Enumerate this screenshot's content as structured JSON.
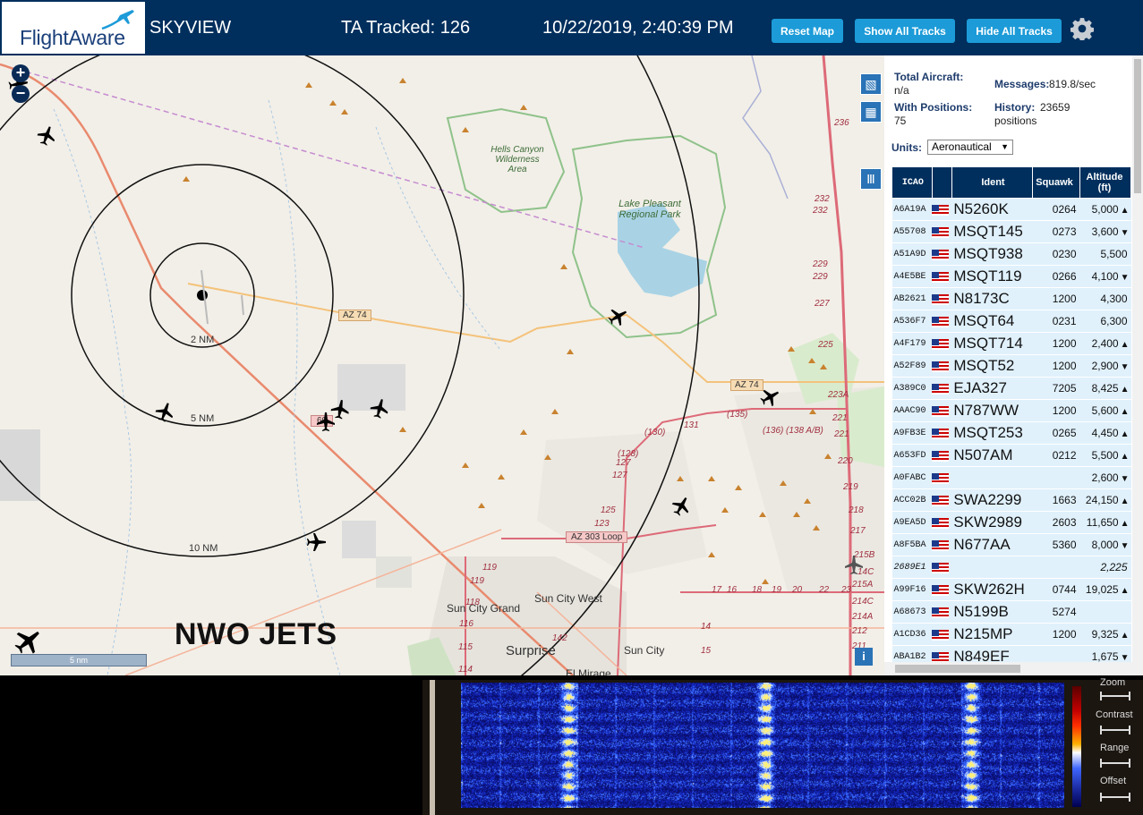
{
  "header": {
    "logo_text": "FlightAware",
    "title": "SKYVIEW",
    "tracked": "TA Tracked: 126",
    "datetime": "10/22/2019, 2:40:39 PM",
    "buttons": [
      "Reset Map",
      "Show All Tracks",
      "Hide All Tracks"
    ]
  },
  "map": {
    "range_labels": [
      "2 NM",
      "5 NM",
      "10 NM"
    ],
    "places": [
      "Hells Canyon Wilderness Area",
      "Lake Pleasant Regional Park",
      "Sun City West",
      "Sun City Grand",
      "Surprise",
      "Sun City",
      "El Mirage"
    ],
    "road_labels": [
      "AZ 74",
      "AZ 74",
      "60",
      "AZ 303 Loop",
      "(130)",
      "131",
      "(135)",
      "(136)",
      "(138 A/B)",
      "(128)",
      "127",
      "127",
      "125",
      "123",
      "119",
      "119",
      "118",
      "116",
      "115",
      "114",
      "142",
      "17",
      "16",
      "18",
      "19",
      "20",
      "22",
      "23",
      "236",
      "232",
      "232",
      "229",
      "229",
      "227",
      "225",
      "223A",
      "221",
      "221",
      "220",
      "219",
      "218",
      "217",
      "215B",
      "215A",
      "214C",
      "214A",
      "212",
      "211",
      "14",
      "15",
      "14C"
    ],
    "scale_label": "5 nm",
    "watermark": "NWO JETS",
    "info": "i"
  },
  "sidebar": {
    "total_aircraft_label": "Total Aircraft:",
    "total_aircraft_value": "n/a",
    "with_positions_label": "With Positions:",
    "with_positions_value": "75",
    "messages_label": "Messages:",
    "messages_value": "819.8/sec",
    "history_label": "History:",
    "history_value": "23659",
    "history_unit": "positions",
    "units_label": "Units:",
    "units_value": "Aeronautical",
    "columns": [
      "ICAO",
      "",
      "Ident",
      "Squawk",
      "Altitude (ft)"
    ],
    "rows": [
      {
        "icao": "A6A19A",
        "ident": "N5260K",
        "squawk": "0264",
        "alt": "5,000",
        "trend": "▲",
        "state": ""
      },
      {
        "icao": "A55708",
        "ident": "MSQT145",
        "squawk": "0273",
        "alt": "3,600",
        "trend": "▼",
        "state": ""
      },
      {
        "icao": "A51A9D",
        "ident": "MSQT938",
        "squawk": "0230",
        "alt": "5,500",
        "trend": "",
        "state": ""
      },
      {
        "icao": "A4E5BE",
        "ident": "MSQT119",
        "squawk": "0266",
        "alt": "4,100",
        "trend": "▼",
        "state": ""
      },
      {
        "icao": "AB2621",
        "ident": "N8173C",
        "squawk": "1200",
        "alt": "4,300",
        "trend": "",
        "state": ""
      },
      {
        "icao": "A536F7",
        "ident": "MSQT64",
        "squawk": "0231",
        "alt": "6,300",
        "trend": "",
        "state": ""
      },
      {
        "icao": "A4F179",
        "ident": "MSQT714",
        "squawk": "1200",
        "alt": "2,400",
        "trend": "▲",
        "state": ""
      },
      {
        "icao": "A52F89",
        "ident": "MSQT52",
        "squawk": "1200",
        "alt": "2,900",
        "trend": "▼",
        "state": ""
      },
      {
        "icao": "A389C0",
        "ident": "EJA327",
        "squawk": "7205",
        "alt": "8,425",
        "trend": "▲",
        "state": ""
      },
      {
        "icao": "AAAC90",
        "ident": "N787WW",
        "squawk": "1200",
        "alt": "5,600",
        "trend": "▲",
        "state": ""
      },
      {
        "icao": "A9FB3E",
        "ident": "MSQT253",
        "squawk": "0265",
        "alt": "4,450",
        "trend": "▲",
        "state": ""
      },
      {
        "icao": "A653FD",
        "ident": "N507AM",
        "squawk": "0212",
        "alt": "5,500",
        "trend": "▲",
        "state": ""
      },
      {
        "icao": "A0FABC",
        "ident": "",
        "squawk": "",
        "alt": "2,600",
        "trend": "▼",
        "state": "sel"
      },
      {
        "icao": "ACC02B",
        "ident": "SWA2299",
        "squawk": "1663",
        "alt": "24,150",
        "trend": "▲",
        "state": ""
      },
      {
        "icao": "A9EA5D",
        "ident": "SKW2989",
        "squawk": "2603",
        "alt": "11,650",
        "trend": "▲",
        "state": ""
      },
      {
        "icao": "A8F5BA",
        "ident": "N677AA",
        "squawk": "5360",
        "alt": "8,000",
        "trend": "▼",
        "state": ""
      },
      {
        "icao": "2689E1",
        "ident": "",
        "squawk": "",
        "alt": "2,225",
        "trend": "",
        "state": "mlat"
      },
      {
        "icao": "A99F16",
        "ident": "SKW262H",
        "squawk": "0744",
        "alt": "19,025",
        "trend": "▲",
        "state": ""
      },
      {
        "icao": "A68673",
        "ident": "N5199B",
        "squawk": "5274",
        "alt": "",
        "trend": "",
        "state": ""
      },
      {
        "icao": "A1CD36",
        "ident": "N215MP",
        "squawk": "1200",
        "alt": "9,325",
        "trend": "▲",
        "state": ""
      },
      {
        "icao": "ABA1B2",
        "ident": "N849EF",
        "squawk": "",
        "alt": "1,675",
        "trend": "▼",
        "state": ""
      }
    ]
  },
  "spectrum": {
    "controls": [
      "Zoom",
      "Contrast",
      "Range",
      "Offset"
    ]
  },
  "colors": {
    "header_bg": "#002f5d",
    "button_bg": "#1c9bd8",
    "row_bg": "#e0f1fc",
    "row_selected": "#d0d4ee",
    "row_mlat": "#fbf0b8"
  }
}
